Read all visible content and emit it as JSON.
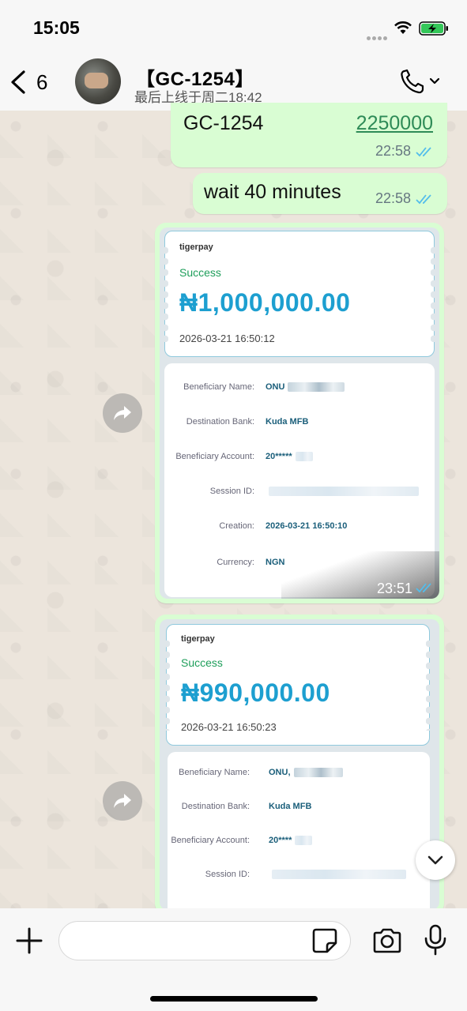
{
  "status_bar": {
    "time": "15:05"
  },
  "header": {
    "back_count": "6",
    "contact_name": "【GC-1254】",
    "last_seen": "最后上线于周二18:42"
  },
  "messages": [
    {
      "type": "text",
      "text": "GC-1254",
      "link": "2250000",
      "time": "22:58"
    },
    {
      "type": "text",
      "text": "wait 40 minutes",
      "time": "22:58"
    },
    {
      "type": "image",
      "time": "23:51",
      "receipt": {
        "brand": "tigerpay",
        "status": "Success",
        "amount": "₦1,000,000.00",
        "datetime": "2026-03-21 16:50:12",
        "details": [
          {
            "label": "Beneficiary Name:",
            "value": "ONU"
          },
          {
            "label": "Destination Bank:",
            "value": "Kuda MFB"
          },
          {
            "label": "Beneficiary Account:",
            "value": "20*****"
          },
          {
            "label": "Session ID:",
            "value": ""
          },
          {
            "label": "Creation:",
            "value": "2026-03-21 16:50:10"
          },
          {
            "label": "Currency:",
            "value": "NGN"
          }
        ]
      }
    },
    {
      "type": "image",
      "receipt": {
        "brand": "tigerpay",
        "status": "Success",
        "amount": "₦990,000.00",
        "datetime": "2026-03-21 16:50:23",
        "details": [
          {
            "label": "Beneficiary Name:",
            "value": "ONU,"
          },
          {
            "label": "Destination Bank:",
            "value": "Kuda MFB"
          },
          {
            "label": "Beneficiary Account:",
            "value": "20****"
          },
          {
            "label": "Session ID:",
            "value": ""
          }
        ]
      }
    }
  ],
  "composer": {
    "placeholder": ""
  },
  "icons": {
    "back": "chevron-left-icon",
    "call": "phone-icon",
    "forward": "forward-arrow-icon",
    "scroll": "chevron-down-icon",
    "attach": "plus-icon",
    "sticker": "sticker-icon",
    "camera": "camera-icon",
    "mic": "microphone-icon"
  },
  "colors": {
    "outgoing_bubble": "#d9fdd3",
    "read_ticks": "#53bdeb",
    "amount": "#1d9fd0",
    "success": "#1e9e5a"
  }
}
